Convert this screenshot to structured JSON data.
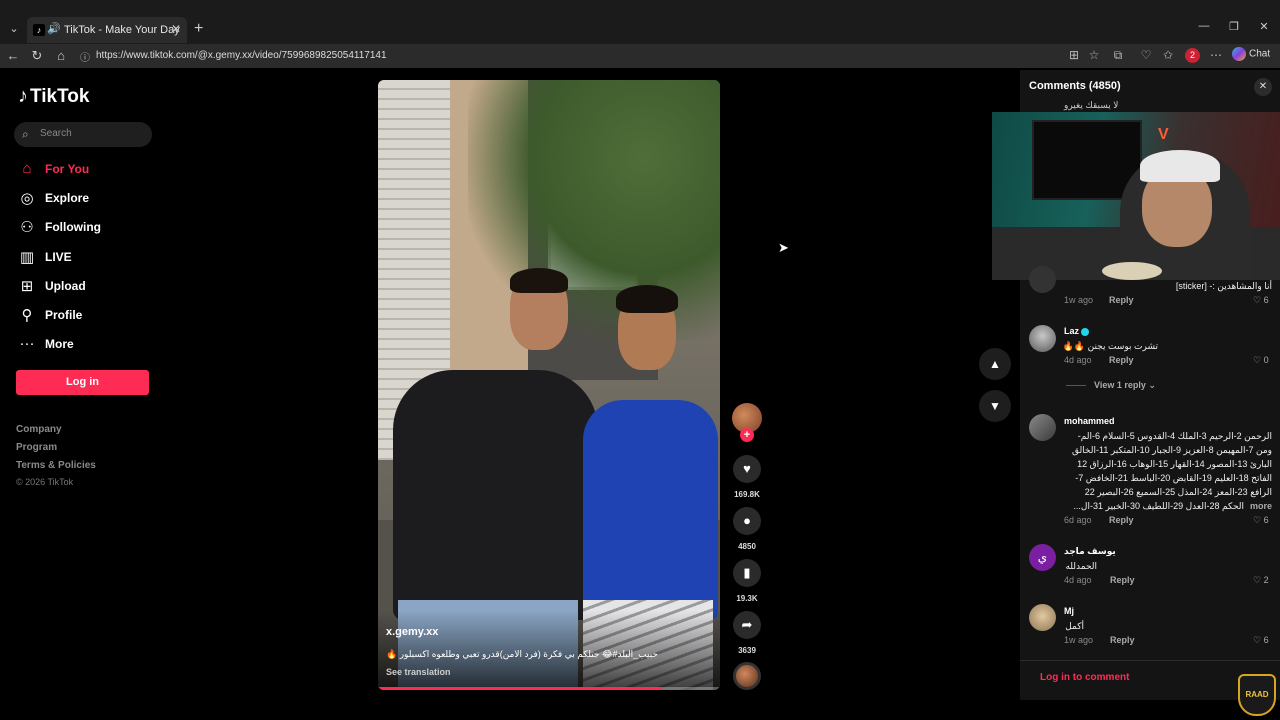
{
  "browser": {
    "tab_title": "TikTok - Make Your Day",
    "url": "https://www.tiktok.com/@x.gemy.xx/video/7599689825054117141",
    "profile_initial": "2",
    "chat_label": "Chat"
  },
  "sidebar": {
    "logo": "TikTok",
    "search_placeholder": "Search",
    "nav": [
      {
        "label": "For You",
        "icon": "home-icon"
      },
      {
        "label": "Explore",
        "icon": "compass-icon"
      },
      {
        "label": "Following",
        "icon": "user-plus-icon"
      },
      {
        "label": "LIVE",
        "icon": "live-tv-icon"
      },
      {
        "label": "Upload",
        "icon": "plus-square-icon"
      },
      {
        "label": "Profile",
        "icon": "person-icon"
      },
      {
        "label": "More",
        "icon": "more-dots-icon"
      }
    ],
    "login_label": "Log in",
    "footer_links": [
      "Company",
      "Program",
      "Terms & Policies"
    ],
    "copyright": "© 2026 TikTok"
  },
  "video": {
    "author": "x.gemy.xx",
    "caption": "حبيب_البلد#😂 جتلكم بي فكرة (فرد الامن)قدرو تعبي وطلعوه اكسبلور 🔥",
    "see_translation": "See translation",
    "progress_fraction": 0.83,
    "likes": "169.8K",
    "comments": "4850",
    "saves": "19.3K",
    "shares": "3639"
  },
  "comments_panel": {
    "title": "Comments  (4850)",
    "truncated_top": "لا يسبقك يغيرو",
    "items": [
      {
        "user": "",
        "text": "أنا والمشاهدين :- [sticker]",
        "time": "1w ago",
        "reply": "Reply",
        "likes": "6"
      },
      {
        "user": "Laz",
        "verified": true,
        "text": "تشرت بوست يجنن 🔥🔥",
        "time": "4d ago",
        "reply": "Reply",
        "likes": "0"
      },
      {
        "user": "mohammed",
        "text_lines": [
          "الرحمن 2-الرحيم 3-الملك 4-القدوس 5-السلام 6-الم-",
          "ومن 7-المهيمن 8-العزيز 9-الجبار 10-المتكبر 11-الخالق",
          "البارئ 13-المصور 14-القهار 15-الوهاب 16-الرزاق 12",
          "الفاتح 18-العليم 19-القابض 20-الباسط 21-الخافض 7-",
          "الرافع 23-المعز 24-المذل 25-السميع 26-البصير 22",
          "الحكم 28-العدل 29-اللطيف 30-الخبير 31-ال..."
        ],
        "more": "more",
        "time": "6d ago",
        "reply": "Reply",
        "likes": "6"
      },
      {
        "user": "يوسف ماجد",
        "text": "الحمدلله",
        "time": "4d ago",
        "reply": "Reply",
        "likes": "2"
      },
      {
        "user": "Mj",
        "text": "أكمل",
        "time": "1w ago",
        "reply": "Reply",
        "likes": "6"
      }
    ],
    "view_reply": "View 1 reply",
    "login_to_comment": "Log in to comment",
    "avatar_letter": "ي"
  },
  "overlay": {
    "badge": "RAAD"
  }
}
